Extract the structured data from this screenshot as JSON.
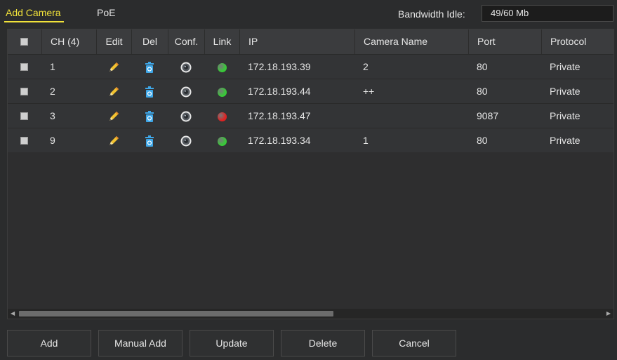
{
  "tabs": {
    "add_camera": "Add Camera",
    "poe": "PoE"
  },
  "bandwidth": {
    "label": "Bandwidth Idle:",
    "value": "49/60 Mb"
  },
  "table": {
    "headers": {
      "ch": "CH (4)",
      "edit": "Edit",
      "del": "Del",
      "conf": "Conf.",
      "link": "Link",
      "ip": "IP",
      "camera_name": "Camera Name",
      "port": "Port",
      "protocol": "Protocol"
    },
    "rows": [
      {
        "ch": "1",
        "ip": "172.18.193.39",
        "camera_name": "2",
        "port": "80",
        "protocol": "Private",
        "link_status": "online"
      },
      {
        "ch": "2",
        "ip": "172.18.193.44",
        "camera_name": "++",
        "port": "80",
        "protocol": "Private",
        "link_status": "online"
      },
      {
        "ch": "3",
        "ip": "172.18.193.47",
        "camera_name": "",
        "port": "9087",
        "protocol": "Private",
        "link_status": "offline"
      },
      {
        "ch": "9",
        "ip": "172.18.193.34",
        "camera_name": "1",
        "port": "80",
        "protocol": "Private",
        "link_status": "online"
      }
    ]
  },
  "icons": {
    "edit": "pencil-icon",
    "del": "trash-icon",
    "conf": "camera-lens-icon"
  },
  "colors": {
    "accent": "#f1e23a",
    "online": "#38c938",
    "offline": "#e02222"
  },
  "buttons": {
    "add": "Add",
    "manual_add": "Manual Add",
    "update": "Update",
    "delete": "Delete",
    "cancel": "Cancel"
  }
}
